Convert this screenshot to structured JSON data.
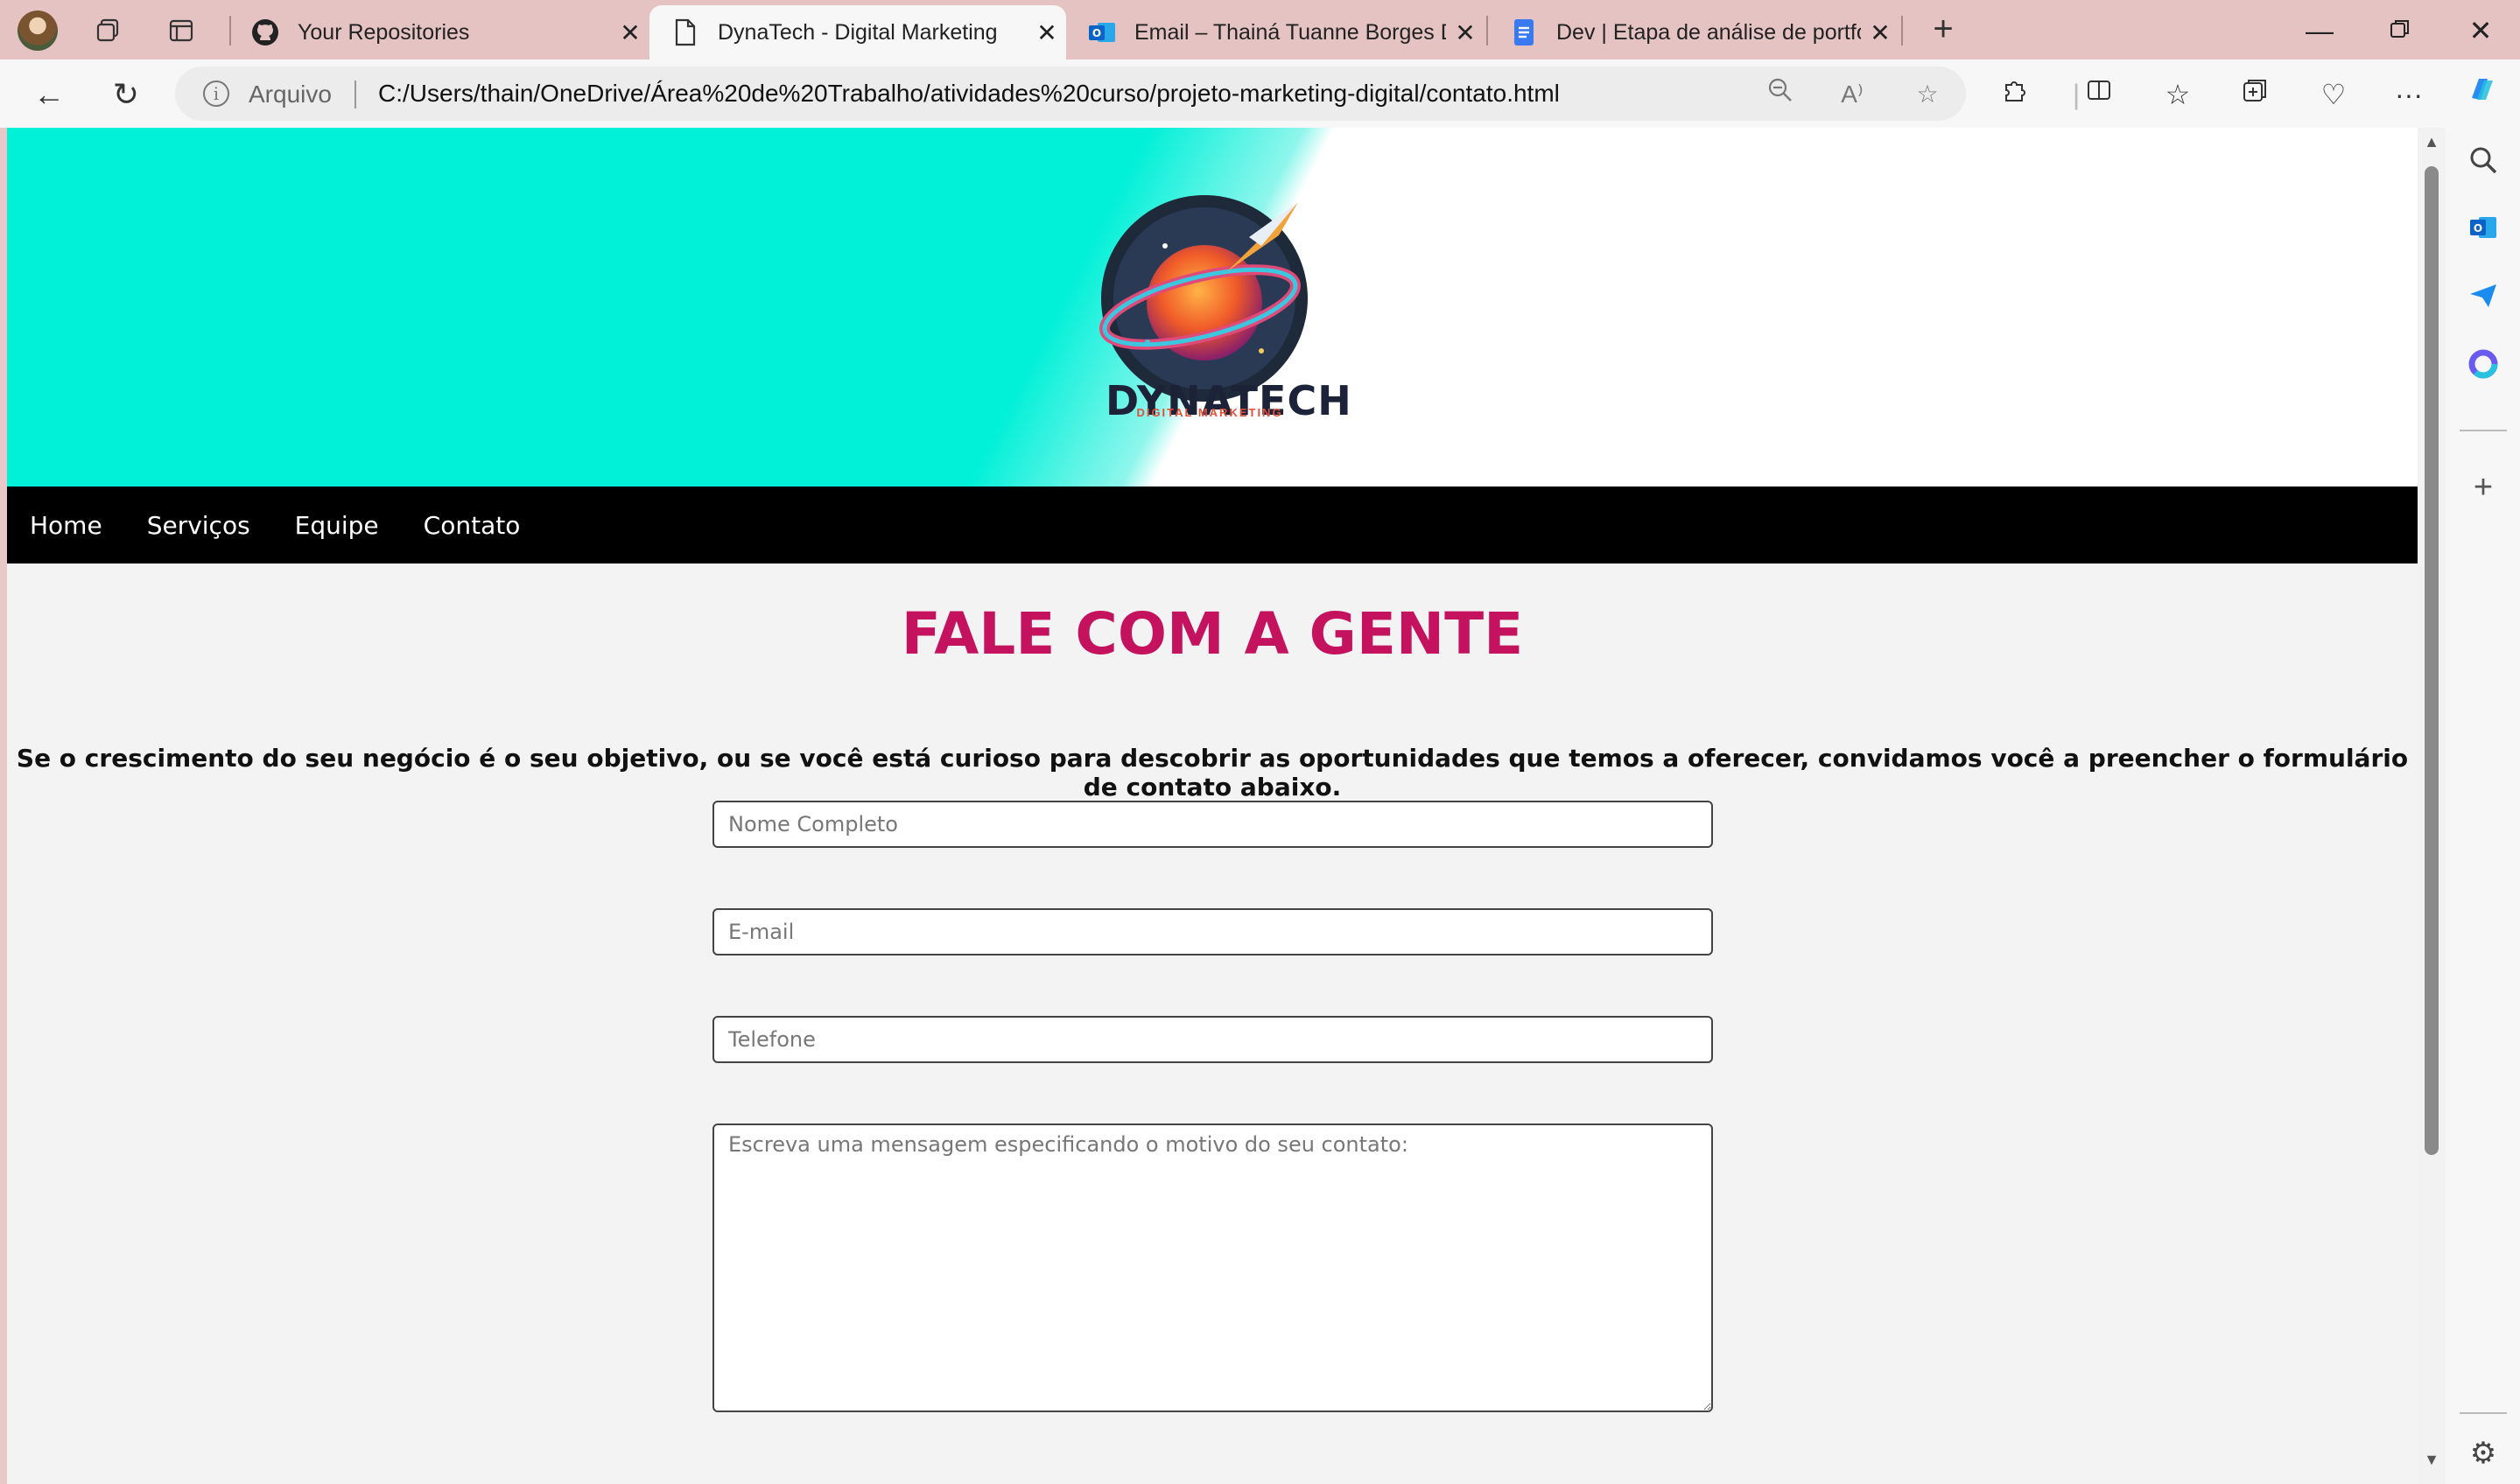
{
  "browser": {
    "tabs": [
      {
        "title": "Your Repositories",
        "icon": "github-icon"
      },
      {
        "title": "DynaTech - Digital Marketing",
        "icon": "page-icon",
        "active": true
      },
      {
        "title": "Email – Thainá Tuanne Borges Da",
        "icon": "outlook-icon"
      },
      {
        "title": "Dev | Etapa de análise de portfóli",
        "icon": "docs-icon"
      }
    ],
    "address": {
      "scheme_label": "Arquivo",
      "url": "C:/Users/thain/OneDrive/Área%20de%20Trabalho/atividades%20curso/projeto-marketing-digital/contato.html"
    }
  },
  "site": {
    "logo": {
      "name": "DYNATECH",
      "tagline": "DIGITAL MARKETING"
    },
    "nav": [
      "Home",
      "Serviços",
      "Equipe",
      "Contato"
    ],
    "heading": "FALE COM A GENTE",
    "intro": "Se o crescimento do seu negócio é o seu objetivo, ou se você está curioso para descobrir as oportunidades que temos a oferecer, convidamos você a preencher o formulário de contato abaixo.",
    "form": {
      "name_placeholder": "Nome Completo",
      "email_placeholder": "E-mail",
      "phone_placeholder": "Telefone",
      "message_placeholder": "Escreva uma mensagem especificando o motivo do seu contato:"
    }
  },
  "colors": {
    "hero_teal": "#00f0d8",
    "heading_pink": "#c4125e",
    "menu_bg": "#000000"
  }
}
